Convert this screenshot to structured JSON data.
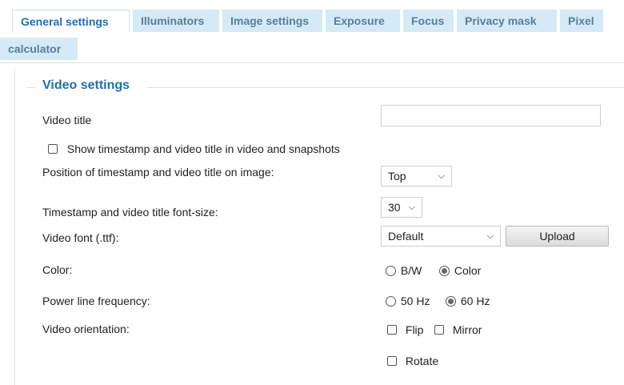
{
  "tabs": [
    {
      "label": "General settings",
      "active": true
    },
    {
      "label": "Illuminators",
      "active": false
    },
    {
      "label": "Image settings",
      "active": false
    },
    {
      "label": "Exposure",
      "active": false
    },
    {
      "label": "Focus",
      "active": false
    },
    {
      "label": "Privacy mask",
      "active": false
    },
    {
      "label": "Pixel",
      "active": false
    },
    {
      "label": "calculator",
      "active": false
    }
  ],
  "section": {
    "title": "Video settings"
  },
  "video_title": {
    "label": "Video title",
    "value": "",
    "placeholder": ""
  },
  "timestamp_checkbox": {
    "label": "Show timestamp and video title in video and snapshots",
    "checked": false
  },
  "position": {
    "label": "Position of timestamp and video title on image:",
    "value": "Top"
  },
  "font_size": {
    "label": "Timestamp and video title font-size:",
    "value": "30"
  },
  "video_font": {
    "label": "Video font (.ttf):",
    "value": "Default",
    "upload_label": "Upload"
  },
  "color": {
    "label": "Color:",
    "options": [
      "B/W",
      "Color"
    ],
    "selected": "Color"
  },
  "power_line": {
    "label": "Power line frequency:",
    "options": [
      "50 Hz",
      "60 Hz"
    ],
    "selected": "60 Hz"
  },
  "orientation": {
    "label": "Video orientation:",
    "flip": "Flip",
    "mirror": "Mirror",
    "rotate": "Rotate"
  },
  "colors": {
    "accent": "#1f6fb5",
    "tab_bg": "#d4eaf7",
    "tab_text": "#5a7e98"
  }
}
